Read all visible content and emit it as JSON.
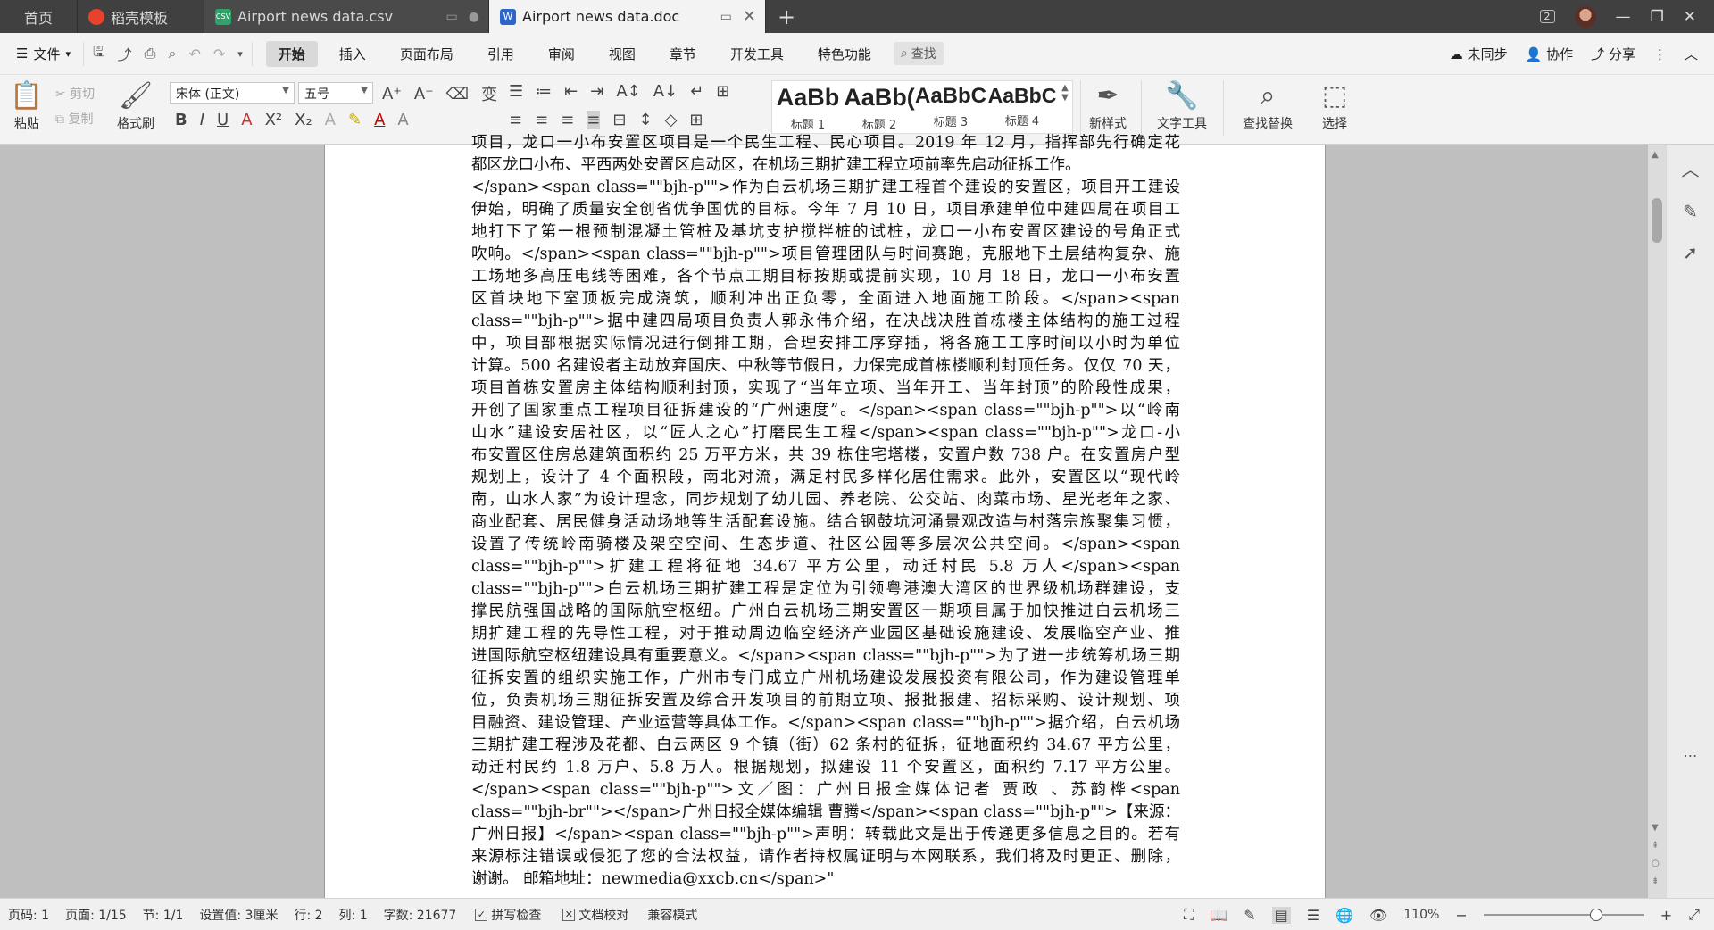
{
  "tabs": {
    "home": "首页",
    "template": "稻壳模板",
    "csv": "Airport news data.csv",
    "doc": "Airport news data.doc",
    "count_badge": "2"
  },
  "menu": {
    "file": "文件",
    "tabs": [
      "开始",
      "插入",
      "页面布局",
      "引用",
      "审阅",
      "视图",
      "章节",
      "开发工具",
      "特色功能"
    ],
    "search": "查找",
    "sync": "未同步",
    "collab": "协作",
    "share": "分享"
  },
  "ribbon": {
    "paste": "粘贴",
    "cut": "剪切",
    "copy": "复制",
    "format_painter": "格式刷",
    "font_name": "宋体 (正文)",
    "font_size": "五号",
    "styles": [
      {
        "preview": "AaBb",
        "name": "标题 1"
      },
      {
        "preview": "AaBb(",
        "name": "标题 2"
      },
      {
        "preview": "AaBbC",
        "name": "标题 3"
      },
      {
        "preview": "AaBbC",
        "name": "标题 4"
      }
    ],
    "new_style": "新样式",
    "text_tools": "文字工具",
    "find_replace": "查找替换",
    "select": "选择"
  },
  "document": {
    "lines": [
      "项目，龙口一小布安置区项目是一个民生工程、民心项目。2019 年 12 月，指挥部先行确定花",
      "都区龙口小布、平西两处安置区启动区，在机场三期扩建工程立项前率先启动征拆工作。",
      "</span><span class=\"\"bjh-p\"\">作为白云机场三期扩建工程首个建设的安置区，项目开工建设",
      "伊始，明确了质量安全创省优争国优的目标。今年 7 月 10 日，项目承建单位中建四局在项目工",
      "地打下了第一根预制混凝土管桩及基坑支护搅拌桩的试桩，龙口一小布安置区建设的号角正式",
      "吹响。</span><span class=\"\"bjh-p\"\">项目管理团队与时间赛跑，克服地下土层结构复杂、施",
      "工场地多高压电线等困难，各个节点工期目标按期或提前实现，10 月 18 日，龙口一小布安置",
      "区首块地下室顶板完成浇筑，顺利冲出正负零，全面进入地面施工阶段。</span><span",
      "class=\"\"bjh-p\"\">据中建四局项目负责人郭永伟介绍，在决战决胜首栋楼主体结构的施工过程",
      "中，项目部根据实际情况进行倒排工期，合理安排工序穿插，将各施工工序时间以小时为单位",
      "计算。500 名建设者主动放弃国庆、中秋等节假日，力保完成首栋楼顺利封顶任务。仅仅 70 天，",
      "项目首栋安置房主体结构顺利封顶，实现了“当年立项、当年开工、当年封顶”的阶段性成果，",
      "开创了国家重点工程项目征拆建设的“广州速度”。</span><span class=\"\"bjh-p\"\">以“岭南",
      "山水”建设安居社区，以“匠人之心”打磨民生工程</span><span class=\"\"bjh-p\"\">龙口-小",
      "布安置区住房总建筑面积约 25 万平方米，共 39 栋住宅塔楼，安置户数 738 户。在安置房户型",
      "规划上，设计了 4 个面积段，南北对流，满足村民多样化居住需求。此外，安置区以“现代岭",
      "南，山水人家”为设计理念，同步规划了幼儿园、养老院、公交站、肉菜市场、星光老年之家、",
      "商业配套、居民健身活动场地等生活配套设施。结合钢鼓坑河涌景观改造与村落宗族聚集习惯，",
      "设置了传统岭南骑楼及架空空间、生态步道、社区公园等多层次公共空间。</span><span",
      "class=\"\"bjh-p\"\">扩建工程将征地 34.67 平方公里，动迁村民 5.8 万人</span><span",
      "class=\"\"bjh-p\"\">白云机场三期扩建工程是定位为引领粤港澳大湾区的世界级机场群建设，支",
      "撑民航强国战略的国际航空枢纽。广州白云机场三期安置区一期项目属于加快推进白云机场三",
      "期扩建工程的先导性工程，对于推动周边临空经济产业园区基础设施建设、发展临空产业、推",
      "进国际航空枢纽建设具有重要意义。</span><span class=\"\"bjh-p\"\">为了进一步统筹机场三期",
      "征拆安置的组织实施工作，广州市专门成立广州机场建设发展投资有限公司，作为建设管理单",
      "位，负责机场三期征拆安置及综合开发项目的前期立项、报批报建、招标采购、设计规划、项",
      "目融资、建设管理、产业运营等具体工作。</span><span class=\"\"bjh-p\"\">据介绍，白云机场",
      "三期扩建工程涉及花都、白云两区 9 个镇（街）62 条村的征拆，征地面积约 34.67 平方公里，",
      "动迁村民约 1.8 万户、5.8 万人。根据规划，拟建设 11 个安置区，面积约 7.17 平方公里。",
      "</span><span class=\"\"bjh-p\"\">文／图：广州日报全媒体记者 贾政 、苏韵桦<span",
      "class=\"\"bjh-br\"\"></span>广州日报全媒体编辑 曹腾</span><span class=\"\"bjh-p\"\">【来源：",
      "广州日报】</span><span class=\"\"bjh-p\"\">声明：转载此文是出于传递更多信息之目的。若有",
      "来源标注错误或侵犯了您的合法权益，请作者持权属证明与本网联系，我们将及时更正、删除，",
      "谢谢。 邮箱地址：newmedia@xxcb.cn</span>\""
    ]
  },
  "status": {
    "page_code": "页码: 1",
    "pages": "页面: 1/15",
    "section": "节: 1/1",
    "setting": "设置值: 3厘米",
    "row": "行: 2",
    "col": "列: 1",
    "words": "字数: 21677",
    "spell": "拼写检查",
    "proof": "文档校对",
    "compat": "兼容模式",
    "zoom": "110%",
    "zoom_level": 0.7
  }
}
